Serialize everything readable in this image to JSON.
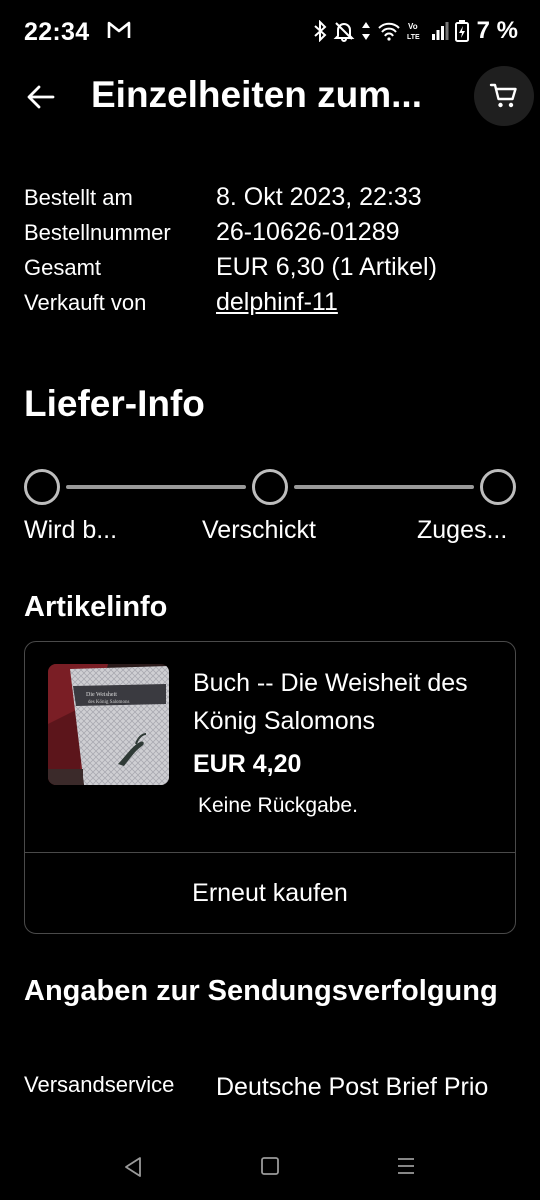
{
  "status_bar": {
    "time": "22:34",
    "battery": "7 %",
    "icons": [
      "gmail-icon",
      "bluetooth-icon",
      "mute-icon",
      "data-arrows-icon",
      "wifi-icon",
      "volte-icon",
      "signal-icon",
      "battery-icon"
    ]
  },
  "header": {
    "title": "Einzelheiten zum..."
  },
  "order": {
    "ordered_on_label": "Bestellt am",
    "ordered_on_value": "8. Okt 2023, 22:33",
    "order_number_label": "Bestellnummer",
    "order_number_value": "26-10626-01289",
    "total_label": "Gesamt",
    "total_value": "EUR 6,30 (1 Artikel)",
    "seller_label": "Verkauft von",
    "seller_value": "delphinf-11"
  },
  "delivery": {
    "heading": "Liefer-Info",
    "steps": [
      "Wird b...",
      "Verschickt",
      "Zuges..."
    ]
  },
  "item_info": {
    "heading": "Artikelinfo",
    "title": "Buch -- Die Weisheit des König Salomons",
    "price": "EUR 4,20",
    "return_policy": "Keine Rückgabe.",
    "rebuy_label": "Erneut kaufen"
  },
  "tracking": {
    "heading": "Angaben zur Sendungsverfolgung",
    "shipping_service_label": "Versandservice",
    "shipping_service_value": "Deutsche Post Brief Prio"
  },
  "colors": {
    "background": "#000000",
    "text": "#ffffff",
    "border": "#4a4a4a",
    "cart_button_bg": "#1f1f1f"
  }
}
